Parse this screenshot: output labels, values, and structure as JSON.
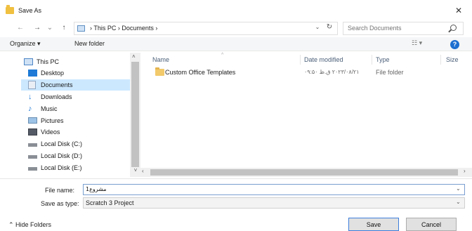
{
  "window": {
    "title": "Save As",
    "close_glyph": "✕"
  },
  "nav": {
    "back_glyph": "←",
    "forward_glyph": "→",
    "recent_glyph": "⌄",
    "up_glyph": "↑",
    "address": {
      "path": "›  This PC  ›  Documents  ›",
      "dropdown_glyph": "⌄",
      "refresh_glyph": "↻"
    },
    "search": {
      "placeholder": "Search Documents"
    }
  },
  "toolbar": {
    "organize_label": "Organize ▾",
    "new_folder_label": "New folder",
    "view_label": "☷ ▾",
    "help_glyph": "?"
  },
  "sidebar": {
    "items": [
      {
        "label": "This PC",
        "icon": "pc-icon"
      },
      {
        "label": "Desktop",
        "icon": "desktop-icon"
      },
      {
        "label": "Documents",
        "icon": "documents-icon"
      },
      {
        "label": "Downloads",
        "icon": "downloads-icon"
      },
      {
        "label": "Music",
        "icon": "music-icon"
      },
      {
        "label": "Pictures",
        "icon": "pictures-icon"
      },
      {
        "label": "Videos",
        "icon": "videos-icon"
      },
      {
        "label": "Local Disk (C:)",
        "icon": "drive-icon"
      },
      {
        "label": "Local Disk (D:)",
        "icon": "drive-icon"
      },
      {
        "label": "Local Disk (E:)",
        "icon": "drive-icon"
      }
    ],
    "selected_index": 2
  },
  "file_list": {
    "columns": {
      "name": "Name",
      "date": "Date modified",
      "type": "Type",
      "size": "Size"
    },
    "rows": [
      {
        "name": "Custom Office Templates",
        "date": "۲۰۲۳/۰۸/۲۱ ق.ظ ۰۹:۵۰",
        "type": "File folder"
      }
    ]
  },
  "form": {
    "file_name_label": "File name:",
    "file_name_value": "مشروع1",
    "save_type_label": "Save as type:",
    "save_type_value": "Scratch 3 Project"
  },
  "footer": {
    "hide_folders_label": "⌃  Hide Folders",
    "save_label": "Save",
    "cancel_label": "Cancel"
  },
  "colors": {
    "accent": "#3d7edb",
    "selection": "#cce8ff",
    "help": "#1e6fd0"
  }
}
